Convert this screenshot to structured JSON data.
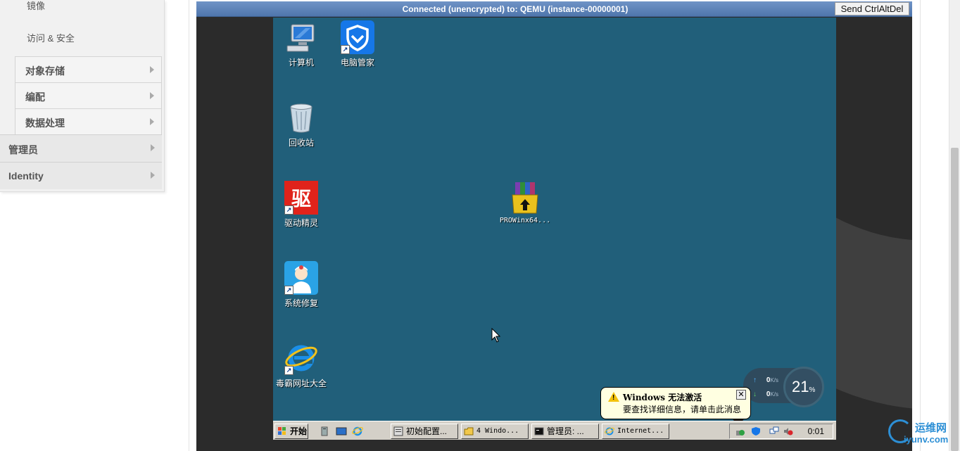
{
  "sidebar": {
    "sub_links": [
      "镜像",
      "访问 & 安全"
    ],
    "panels": [
      "对象存储",
      "编配",
      "数据处理"
    ],
    "dashboards": [
      "管理员",
      "Identity"
    ]
  },
  "console": {
    "status": "Connected (unencrypted) to: QEMU (instance-00000001)",
    "send_ctrl_alt_del": "Send CtrlAltDel"
  },
  "desktop": {
    "icons": {
      "computer": "计算机",
      "pc_manager": "电脑管家",
      "recycle_bin": "回收站",
      "driver_genius": "驱动精灵",
      "system_repair": "系统修复",
      "browser": "毒霸网址大全",
      "archive": "PROWinx64..."
    },
    "driver_genius_glyph": "驱",
    "balloon": {
      "title": "Windows 无法激活",
      "message": "要查找详细信息，请单击此消息",
      "close": "✕"
    },
    "speed": {
      "up": "0",
      "down": "0",
      "unit": "K/s"
    },
    "gauge": {
      "value": "21",
      "unit": "%"
    },
    "taskbar": {
      "start": "开始",
      "tasks": [
        "初始配置...",
        "4 Windo...",
        "管理员: ...",
        "Internet..."
      ],
      "clock": "0:01"
    }
  },
  "watermark": {
    "line1": "运维网",
    "line2": "iyunv.com"
  }
}
